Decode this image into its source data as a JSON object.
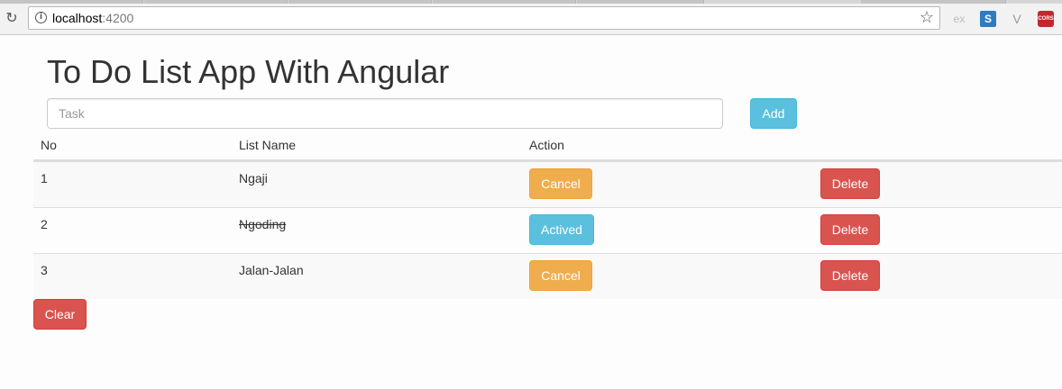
{
  "browser": {
    "url_host": "localhost",
    "url_port": ":4200",
    "extensions": [
      {
        "icon": "ex-extension-icon",
        "label": "ex"
      },
      {
        "icon": "s-extension-icon",
        "label": "S"
      },
      {
        "icon": "v-extension-icon",
        "label": "V"
      },
      {
        "icon": "cors-extension-icon",
        "label": "CORS"
      }
    ]
  },
  "page": {
    "title": "To Do List App With Angular",
    "task_placeholder": "Task",
    "task_value": "",
    "add_label": "Add",
    "clear_label": "Clear"
  },
  "table": {
    "headers": {
      "no": "No",
      "name": "List Name",
      "action": "Action"
    },
    "rows": [
      {
        "no": "1",
        "name": "Ngaji",
        "action_label": "Cancel",
        "action_style": "warning",
        "done": false,
        "delete_label": "Delete"
      },
      {
        "no": "2",
        "name": "Ngoding",
        "action_label": "Actived",
        "action_style": "info",
        "done": true,
        "delete_label": "Delete"
      },
      {
        "no": "3",
        "name": "Jalan-Jalan",
        "action_label": "Cancel",
        "action_style": "warning",
        "done": false,
        "delete_label": "Delete"
      }
    ]
  },
  "colors": {
    "info": "#5bc0de",
    "warning": "#f0ad4e",
    "danger": "#d9534f"
  }
}
